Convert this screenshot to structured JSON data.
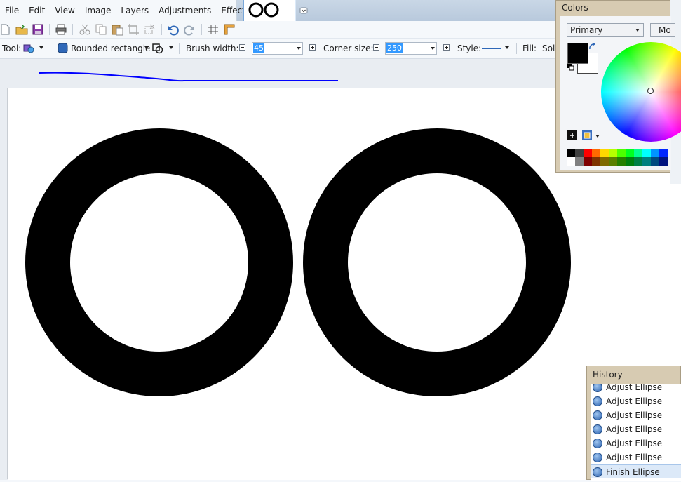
{
  "menu": [
    "File",
    "Edit",
    "View",
    "Image",
    "Layers",
    "Adjustments",
    "Effects"
  ],
  "toolbar": {
    "tool_label": "Tool:",
    "shape_label": "Rounded rectangle",
    "brush_width_label": "Brush width:",
    "brush_width_value": "45",
    "corner_size_label": "Corner size:",
    "corner_size_value": "250",
    "style_label": "Style:",
    "fill_label": "Fill:",
    "fill_value": "Soli"
  },
  "colors_panel": {
    "title": "Colors",
    "mode": "Primary",
    "more_button": "Mo",
    "primary_color": "#000000",
    "secondary_color": "#ffffff",
    "palette": [
      "#000000",
      "#404040",
      "#ff0000",
      "#ff6a00",
      "#ffd800",
      "#b6ff00",
      "#4cff00",
      "#00ff21",
      "#00ff90",
      "#00ffff",
      "#0094ff",
      "#0026ff",
      "#ffffff",
      "#808080",
      "#7f0000",
      "#7f3300",
      "#7f6a00",
      "#5b7f00",
      "#267f00",
      "#007f0e",
      "#007f46",
      "#007f7f",
      "#004a7f",
      "#00137f"
    ]
  },
  "history_panel": {
    "title": "History",
    "items": [
      "Adjust Ellipse",
      "Adjust Ellipse",
      "Adjust Ellipse",
      "Adjust Ellipse",
      "Adjust Ellipse",
      "Adjust Ellipse",
      "Finish Ellipse"
    ],
    "selected_index": 6
  },
  "colors": {
    "accent": "#3399ff",
    "panel_bg": "#d7cbb2",
    "canvas": "#ffffff",
    "stroke": "#0000ff"
  }
}
